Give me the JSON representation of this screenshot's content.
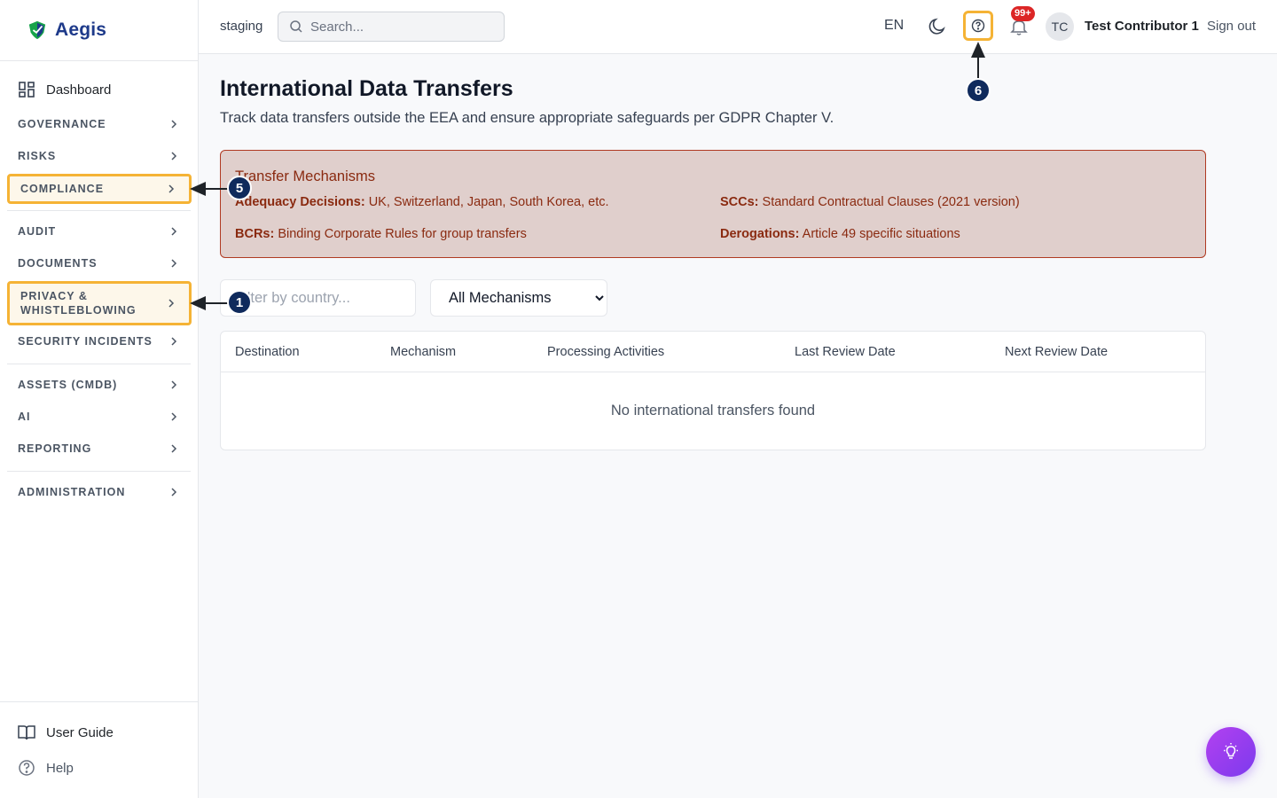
{
  "brand": {
    "name": "Aegis"
  },
  "sidebar": {
    "dashboard": "Dashboard",
    "items": [
      {
        "label": "GOVERNANCE"
      },
      {
        "label": "RISKS"
      },
      {
        "label": "COMPLIANCE"
      },
      {
        "label": "AUDIT"
      },
      {
        "label": "DOCUMENTS"
      },
      {
        "label": "PRIVACY & WHISTLEBLOWING"
      },
      {
        "label": "SECURITY INCIDENTS"
      },
      {
        "label": "ASSETS (CMDB)"
      },
      {
        "label": "AI"
      },
      {
        "label": "REPORTING"
      },
      {
        "label": "ADMINISTRATION"
      }
    ],
    "footer": {
      "user_guide": "User Guide",
      "help": "Help"
    }
  },
  "topbar": {
    "environment": "staging",
    "search_placeholder": "Search...",
    "language": "EN",
    "notification_count": "99+",
    "avatar_initials": "TC",
    "user_name": "Test Contributor 1",
    "sign_out": "Sign out"
  },
  "page": {
    "title": "International Data Transfers",
    "subtitle": "Track data transfers outside the EEA and ensure appropriate safeguards per GDPR Chapter V."
  },
  "mechanisms_panel": {
    "title": "Transfer Mechanisms",
    "adequacy_label": "Adequacy Decisions:",
    "adequacy_text": " UK, Switzerland, Japan, South Korea, etc.",
    "sccs_label": "SCCs:",
    "sccs_text": " Standard Contractual Clauses (2021 version)",
    "bcrs_label": "BCRs:",
    "bcrs_text": " Binding Corporate Rules for group transfers",
    "derogations_label": "Derogations:",
    "derogations_text": " Article 49 specific situations"
  },
  "filters": {
    "country_placeholder": "Filter by country...",
    "mechanism_options": [
      "All Mechanisms"
    ]
  },
  "table": {
    "columns": [
      "Destination",
      "Mechanism",
      "Processing Activities",
      "Last Review Date",
      "Next Review Date"
    ],
    "empty_message": "No international transfers found"
  },
  "annotations": {
    "marker_1": "1",
    "marker_5": "5",
    "marker_6": "6"
  },
  "colors": {
    "highlight": "#f5b335",
    "marker": "#0f2a5c",
    "panel_bg": "#e0cfcc",
    "panel_border": "#b03a22",
    "badge": "#dc2626"
  },
  "icons": [
    "aegis-shield-logo",
    "dashboard-grid-icon",
    "chevron-right-icon",
    "book-icon",
    "help-circle-icon",
    "search-icon",
    "moon-icon",
    "question-icon",
    "bell-icon",
    "lightbulb-icon"
  ]
}
